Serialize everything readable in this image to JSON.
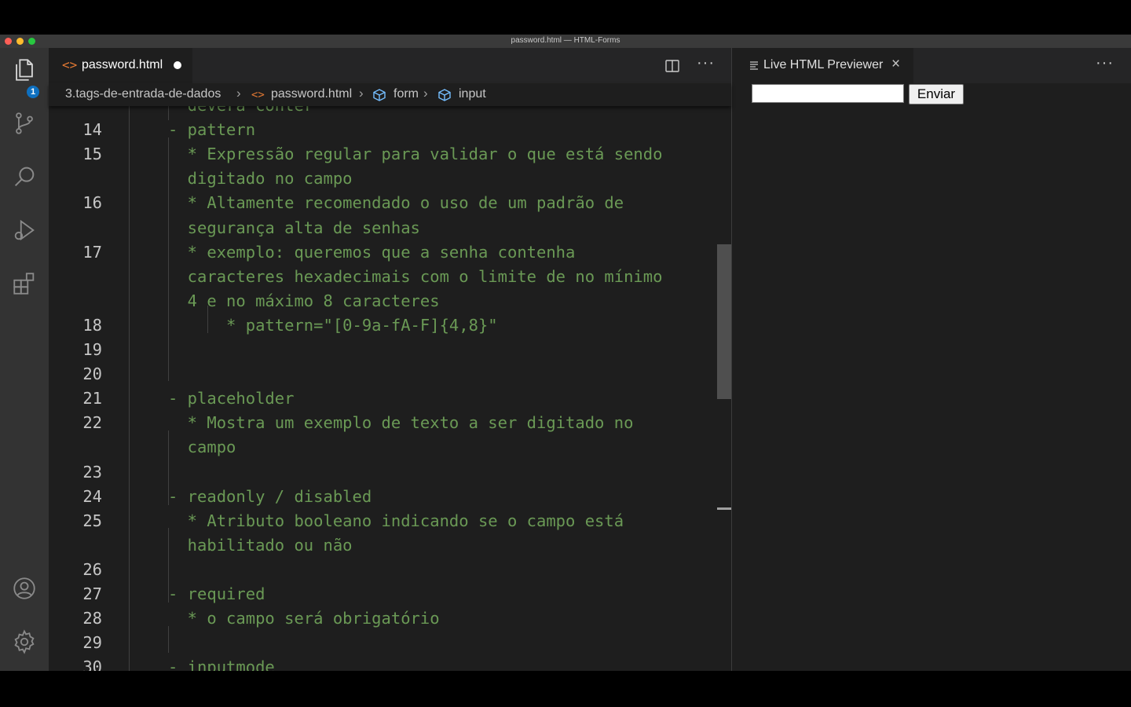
{
  "window": {
    "title": "password.html — HTML-Forms"
  },
  "activity_bar": {
    "explorer_badge": "1"
  },
  "editor": {
    "tab_label": "password.html",
    "tab_icon_text": "<>",
    "more_label": "···",
    "breadcrumb": {
      "folder": "3.tags-de-entrada-de-dados",
      "file": "password.html",
      "element1": "form",
      "element2": "input"
    },
    "lines": [
      {
        "num": "",
        "text": "  deverá conter"
      },
      {
        "num": "14",
        "text": "- pattern"
      },
      {
        "num": "15",
        "text": "  * Expressão regular para validar o que está sendo"
      },
      {
        "num": "",
        "text": "  digitado no campo"
      },
      {
        "num": "16",
        "text": "  * Altamente recomendado o uso de um padrão de"
      },
      {
        "num": "",
        "text": "  segurança alta de senhas"
      },
      {
        "num": "17",
        "text": "  * exemplo: queremos que a senha contenha"
      },
      {
        "num": "",
        "text": "  caracteres hexadecimais com o limite de no mínimo"
      },
      {
        "num": "",
        "text": "  4 e no máximo 8 caracteres"
      },
      {
        "num": "18",
        "text": "      * pattern=\"[0-9a-fA-F]{4,8}\""
      },
      {
        "num": "19",
        "text": ""
      },
      {
        "num": "20",
        "text": ""
      },
      {
        "num": "21",
        "text": "- placeholder"
      },
      {
        "num": "22",
        "text": "  * Mostra um exemplo de texto a ser digitado no"
      },
      {
        "num": "",
        "text": "  campo"
      },
      {
        "num": "23",
        "text": ""
      },
      {
        "num": "24",
        "text": "- readonly / disabled"
      },
      {
        "num": "25",
        "text": "  * Atributo booleano indicando se o campo está"
      },
      {
        "num": "",
        "text": "  habilitado ou não"
      },
      {
        "num": "26",
        "text": ""
      },
      {
        "num": "27",
        "text": "- required"
      },
      {
        "num": "28",
        "text": "  * o campo será obrigatório"
      },
      {
        "num": "29",
        "text": ""
      },
      {
        "num": "30",
        "text": "- inputmode"
      }
    ]
  },
  "preview": {
    "tab_label": "Live HTML Previewer",
    "close_label": "×",
    "more_label": "···",
    "input_value": "",
    "button_label": "Enviar"
  },
  "colors": {
    "comment_green": "#6a9955",
    "editor_bg": "#1e1e1e",
    "activity_bg": "#333333",
    "badge_blue": "#0e70c0",
    "html_icon_orange": "#e37933"
  }
}
